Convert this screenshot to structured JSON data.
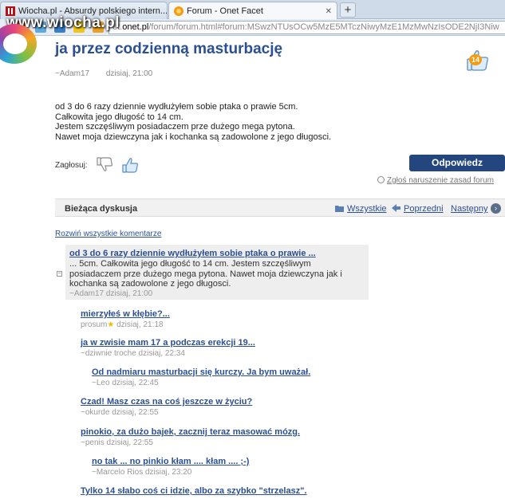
{
  "browser": {
    "tabs": [
      {
        "label": "Wiocha.pl - Absurdy polskiego intern...",
        "close": "✕"
      },
      {
        "label": "Forum - Onet Facet",
        "close": "✕"
      }
    ],
    "new_tab": "+",
    "url_prefix": "et.",
    "url_domain": "onet.pl",
    "url_rest": "/forum/forum.html#forum:MSwzNTUsOCw5MzE5MTczNiwyMzE1MzMwNzIsODE2NjI3Niw",
    "watermark": "www.wiocha.pl"
  },
  "thread": {
    "title": "ja przez codzienną masturbację",
    "like_count": "14",
    "author": "~Adam17",
    "date": "dzisiaj, 21:00",
    "body_lines": [
      "od 3 do 6 razy dziennie wydłużyłem sobie ptaka o prawie 5cm.",
      "Całkowita jego długość to 14 cm.",
      "Jestem szczęśliwym posiadaczem prze dużego mega pytona.",
      "Nawet moja dziewczyna jak i kochanka są zadowolone z jego długosci."
    ],
    "vote_label": "Zagłosuj:",
    "reply_button": "Odpowiedz",
    "report_link": "Zgłoś naruszenie zasad forum"
  },
  "discussion": {
    "label": "Bieżąca dyskusja",
    "all_link": "Wszystkie",
    "prev_link": "Poprzedni",
    "next_link": "Następny",
    "next_arrow": "›",
    "expand_all": "Rozwiń wszystkie komentarze"
  },
  "first_comment": {
    "collapse": "−",
    "title": "od 3 do 6 razy dziennie wydłużyłem sobie ptaka o prawie ...",
    "text": "... 5cm. Całkowita jego długość to 14 cm. Jestem szczęśliwym posiadaczem prze dużego mega pytona. Nawet moja dziewczyna jak i kochanka są zadowolone z jego długosci.",
    "meta": "~Adam17 dzisiaj, 21:00"
  },
  "comments": [
    {
      "title": "mierzyłeś w kłębie?...",
      "author": "prosum",
      "star": "★",
      "date": "dzisiaj, 21:18"
    },
    {
      "title": "ja w zwisie mam 17 a podczas erekcji 19...",
      "author": "~dziwnie troche",
      "date": "dzisiaj, 22:34"
    },
    {
      "title": "Od nadmiaru masturbacji się kurczy. Ja bym uważał.",
      "author": "~Leo",
      "date": "dzisiaj, 22:45"
    },
    {
      "title": "Czad! Masz czas na coś jeszcze w życiu?",
      "author": "~okurde",
      "date": "dzisiaj, 22:55"
    },
    {
      "title": "pinokio, za dużo bajek, zacznij teraz masować mózg.",
      "author": "~penis",
      "date": "dzisiaj, 22:55"
    },
    {
      "title": "no tak ... no pinkio kłam .... kłam .... ;-)",
      "author": "~Marcelo Rios",
      "date": "dzisiaj, 23:20"
    },
    {
      "title": "Tylko 14 słabo coś ci idzie, albo za szybko \"strzelasz\".",
      "author": "",
      "date": ""
    }
  ],
  "colors": {
    "link": "#2b4f93",
    "button": "#24467e",
    "comment_bg": "#eeeeee"
  }
}
